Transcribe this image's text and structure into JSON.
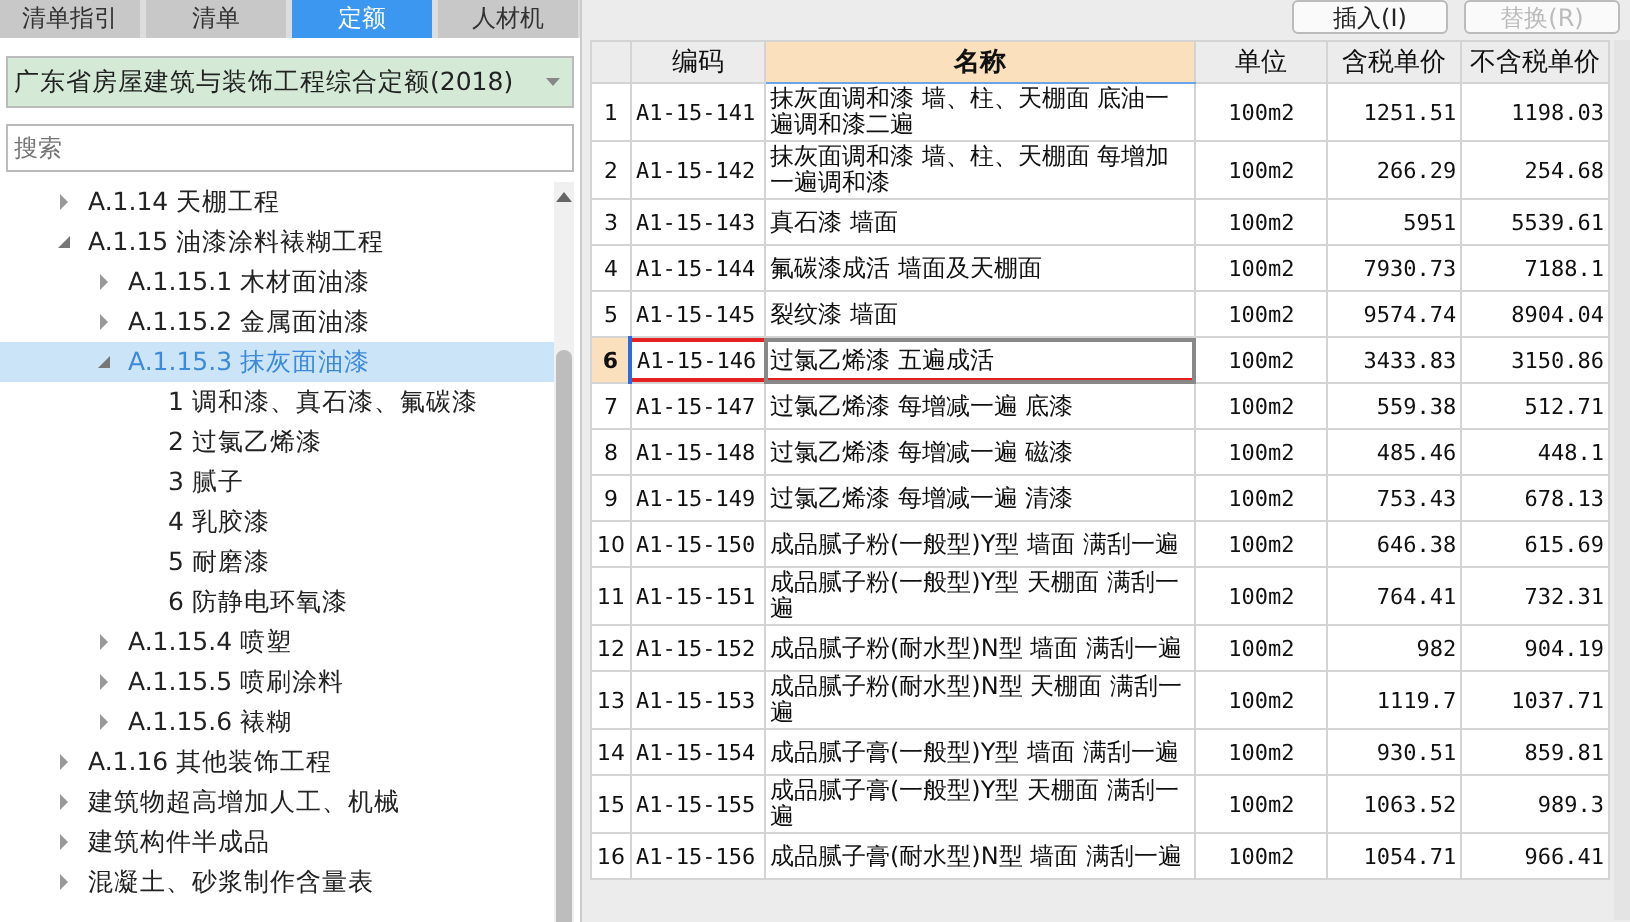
{
  "tabs": [
    {
      "label": "清单指引",
      "selected": false
    },
    {
      "label": "清单",
      "selected": false
    },
    {
      "label": "定额",
      "selected": true
    },
    {
      "label": "人材机",
      "selected": false
    }
  ],
  "library_dropdown": {
    "value": "广东省房屋建筑与装饰工程综合定额(2018)"
  },
  "search": {
    "placeholder": "搜索"
  },
  "tree": [
    {
      "label": "A.1.14 天棚工程",
      "expanded": false,
      "selected": false
    },
    {
      "label": "A.1.15 油漆涂料裱糊工程",
      "expanded": true,
      "selected": false,
      "children": [
        {
          "label": "A.1.15.1 木材面油漆",
          "expanded": false,
          "selected": false
        },
        {
          "label": "A.1.15.2 金属面油漆",
          "expanded": false,
          "selected": false
        },
        {
          "label": "A.1.15.3 抹灰面油漆",
          "expanded": true,
          "selected": true,
          "children": [
            {
              "label": "1 调和漆、真石漆、氟碳漆",
              "selected": false
            },
            {
              "label": "2 过氯乙烯漆",
              "selected": false
            },
            {
              "label": "3 腻子",
              "selected": false
            },
            {
              "label": "4 乳胶漆",
              "selected": false
            },
            {
              "label": "5 耐磨漆",
              "selected": false
            },
            {
              "label": "6 防静电环氧漆",
              "selected": false
            }
          ]
        },
        {
          "label": "A.1.15.4 喷塑",
          "expanded": false,
          "selected": false
        },
        {
          "label": "A.1.15.5 喷刷涂料",
          "expanded": false,
          "selected": false
        },
        {
          "label": "A.1.15.6 裱糊",
          "expanded": false,
          "selected": false
        }
      ]
    },
    {
      "label": "A.1.16 其他装饰工程",
      "expanded": false,
      "selected": false
    },
    {
      "label": "建筑物超高增加人工、机械",
      "expanded": false,
      "selected": false
    },
    {
      "label": "建筑构件半成品",
      "expanded": false,
      "selected": false
    },
    {
      "label": "混凝土、砂浆制作含量表",
      "expanded": false,
      "selected": false
    }
  ],
  "toolbar": [
    {
      "label": "插入(I)",
      "disabled": false
    },
    {
      "label": "替换(R)",
      "disabled": true
    }
  ],
  "table": {
    "columns": [
      "编码",
      "名称",
      "单位",
      "含税单价",
      "不含税单价"
    ],
    "rows": [
      {
        "no": "1",
        "code": "A1-15-141",
        "name": "抹灰面调和漆 墙、柱、天棚面 底油一遍调和漆二遍",
        "unit": "100m2",
        "price_tax": "1251.51",
        "price_notax": "1198.03",
        "selected": false
      },
      {
        "no": "2",
        "code": "A1-15-142",
        "name": "抹灰面调和漆 墙、柱、天棚面 每增加一遍调和漆",
        "unit": "100m2",
        "price_tax": "266.29",
        "price_notax": "254.68",
        "selected": false
      },
      {
        "no": "3",
        "code": "A1-15-143",
        "name": "真石漆 墙面",
        "unit": "100m2",
        "price_tax": "5951",
        "price_notax": "5539.61",
        "selected": false
      },
      {
        "no": "4",
        "code": "A1-15-144",
        "name": "氟碳漆成活 墙面及天棚面",
        "unit": "100m2",
        "price_tax": "7930.73",
        "price_notax": "7188.1",
        "selected": false
      },
      {
        "no": "5",
        "code": "A1-15-145",
        "name": "裂纹漆 墙面",
        "unit": "100m2",
        "price_tax": "9574.74",
        "price_notax": "8904.04",
        "selected": false
      },
      {
        "no": "6",
        "code": "A1-15-146",
        "name": "过氯乙烯漆 五遍成活",
        "unit": "100m2",
        "price_tax": "3433.83",
        "price_notax": "3150.86",
        "selected": true
      },
      {
        "no": "7",
        "code": "A1-15-147",
        "name": "过氯乙烯漆 每增减一遍 底漆",
        "unit": "100m2",
        "price_tax": "559.38",
        "price_notax": "512.71",
        "selected": false
      },
      {
        "no": "8",
        "code": "A1-15-148",
        "name": "过氯乙烯漆 每增减一遍 磁漆",
        "unit": "100m2",
        "price_tax": "485.46",
        "price_notax": "448.1",
        "selected": false
      },
      {
        "no": "9",
        "code": "A1-15-149",
        "name": "过氯乙烯漆 每增减一遍 清漆",
        "unit": "100m2",
        "price_tax": "753.43",
        "price_notax": "678.13",
        "selected": false
      },
      {
        "no": "10",
        "code": "A1-15-150",
        "name": "成品腻子粉(一般型)Y型 墙面 满刮一遍",
        "unit": "100m2",
        "price_tax": "646.38",
        "price_notax": "615.69",
        "selected": false
      },
      {
        "no": "11",
        "code": "A1-15-151",
        "name": "成品腻子粉(一般型)Y型 天棚面 满刮一遍",
        "unit": "100m2",
        "price_tax": "764.41",
        "price_notax": "732.31",
        "selected": false
      },
      {
        "no": "12",
        "code": "A1-15-152",
        "name": "成品腻子粉(耐水型)N型 墙面 满刮一遍",
        "unit": "100m2",
        "price_tax": "982",
        "price_notax": "904.19",
        "selected": false
      },
      {
        "no": "13",
        "code": "A1-15-153",
        "name": "成品腻子粉(耐水型)N型 天棚面 满刮一遍",
        "unit": "100m2",
        "price_tax": "1119.7",
        "price_notax": "1037.71",
        "selected": false
      },
      {
        "no": "14",
        "code": "A1-15-154",
        "name": "成品腻子膏(一般型)Y型 墙面 满刮一遍",
        "unit": "100m2",
        "price_tax": "930.51",
        "price_notax": "859.81",
        "selected": false
      },
      {
        "no": "15",
        "code": "A1-15-155",
        "name": "成品腻子膏(一般型)Y型 天棚面 满刮一遍",
        "unit": "100m2",
        "price_tax": "1063.52",
        "price_notax": "989.3",
        "selected": false
      },
      {
        "no": "16",
        "code": "A1-15-156",
        "name": "成品腻子膏(耐水型)N型 墙面 满刮一遍",
        "unit": "100m2",
        "price_tax": "1054.71",
        "price_notax": "966.41",
        "selected": false
      }
    ]
  }
}
